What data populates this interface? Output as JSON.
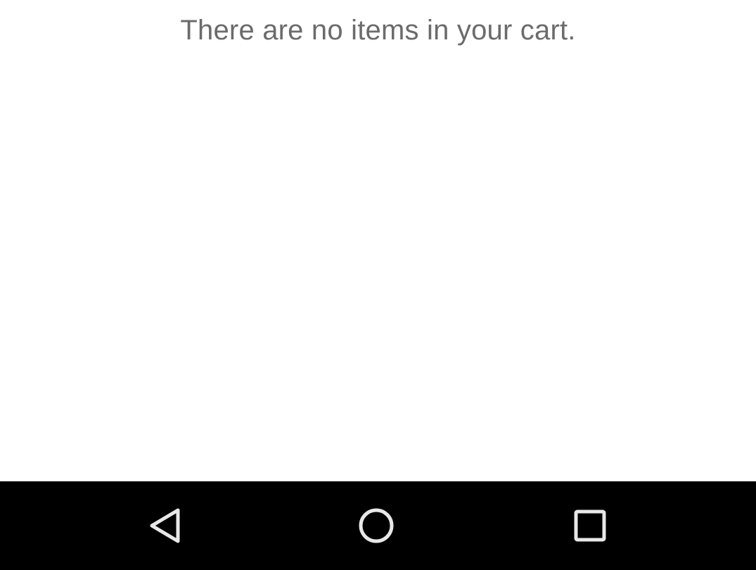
{
  "cart": {
    "empty_message": "There are no items in your cart."
  },
  "navigation_bar": {
    "background": "#000000",
    "icon_color": "#e8e8e8",
    "buttons": [
      {
        "icon": "back-icon"
      },
      {
        "icon": "home-icon"
      },
      {
        "icon": "recents-icon"
      }
    ]
  },
  "colors": {
    "page_background": "#ffffff",
    "message_text": "#6b6b6b"
  }
}
